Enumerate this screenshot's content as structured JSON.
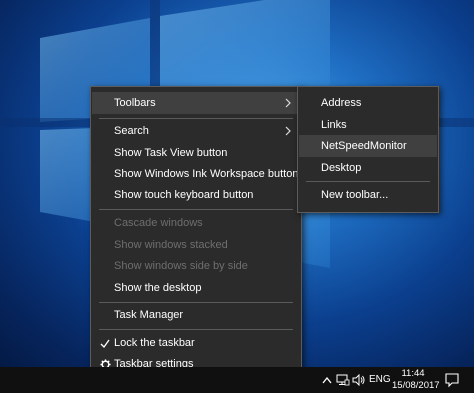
{
  "main_menu": {
    "items": [
      {
        "label": "Toolbars"
      },
      {
        "label": "Search"
      },
      {
        "label": "Show Task View button"
      },
      {
        "label": "Show Windows Ink Workspace button"
      },
      {
        "label": "Show touch keyboard button"
      },
      {
        "label": "Cascade windows"
      },
      {
        "label": "Show windows stacked"
      },
      {
        "label": "Show windows side by side"
      },
      {
        "label": "Show the desktop"
      },
      {
        "label": "Task Manager"
      },
      {
        "label": "Lock the taskbar"
      },
      {
        "label": "Taskbar settings"
      }
    ]
  },
  "submenu": {
    "items": [
      {
        "label": "Address"
      },
      {
        "label": "Links"
      },
      {
        "label": "NetSpeedMonitor"
      },
      {
        "label": "Desktop"
      },
      {
        "label": "New toolbar..."
      }
    ]
  },
  "taskbar": {
    "language": "ENG",
    "time": "11:44",
    "date": "15/08/2017"
  },
  "colors": {
    "menu_bg": "#2b2b2b",
    "menu_highlight": "#404040",
    "disabled_text": "#6e6e6e",
    "taskbar_bg": "#101010"
  },
  "icons": [
    "windows-logo",
    "chevron-right-icon",
    "checkmark-icon",
    "gear-icon",
    "up-arrow-icon",
    "network-icon",
    "volume-icon",
    "notification-icon"
  ]
}
